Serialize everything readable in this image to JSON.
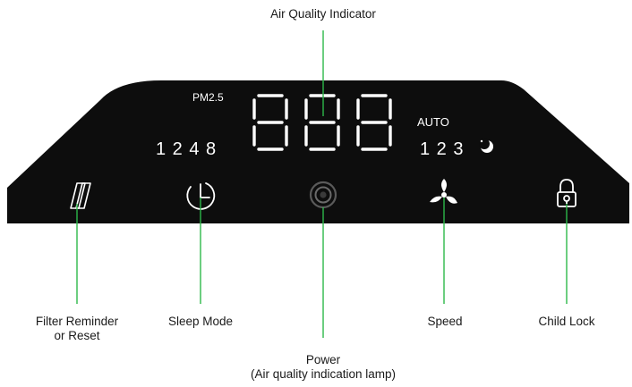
{
  "display": {
    "pm_label": "PM2.5",
    "timer_numbers": "1 2 4 8",
    "speed_mode_label": "AUTO",
    "speed_numbers": "1 2 3",
    "digits": "888"
  },
  "callouts": {
    "air_quality_indicator": "Air Quality Indicator",
    "filter_line1": "Filter Reminder",
    "filter_line2": "or Reset",
    "sleep_mode": "Sleep Mode",
    "power_line1": "Power",
    "power_line2": "(Air quality indication lamp)",
    "speed": "Speed",
    "child_lock": "Child Lock"
  },
  "icons": [
    "filter-icon",
    "clock-icon",
    "power-icon",
    "fan-icon",
    "lock-icon",
    "moon-icon"
  ],
  "colors": {
    "panel": "#0d0d0d",
    "leader_line": "#2db84a",
    "power_ring": "#5a5a5a",
    "text": "#1a1a1a"
  }
}
